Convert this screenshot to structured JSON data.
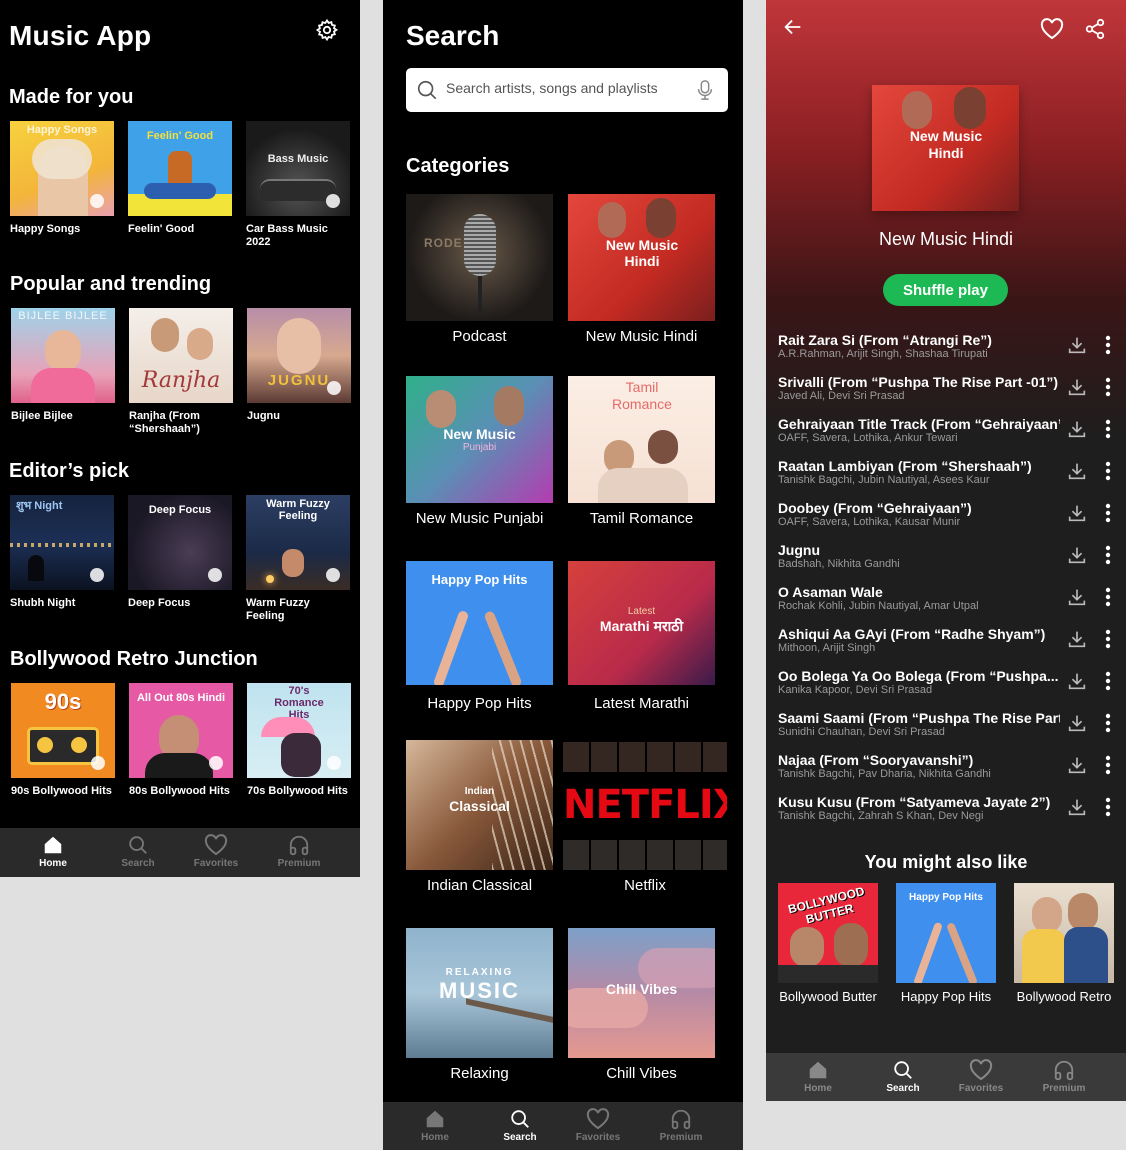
{
  "home": {
    "app_title": "Music App",
    "sections": [
      {
        "title": "Made for you",
        "items": [
          {
            "label": "Happy Songs",
            "art_text": "Happy Songs"
          },
          {
            "label": "Feelin' Good",
            "art_text": "Feelin' Good"
          },
          {
            "label": "Car Bass Music 2022",
            "art_text": "Bass Music"
          }
        ]
      },
      {
        "title": "Popular and trending",
        "items": [
          {
            "label": "Bijlee Bijlee",
            "art_text": "BIJLEE BIJLEE"
          },
          {
            "label": "Ranjha (From “Shershaah”)",
            "art_text": "Ranjha"
          },
          {
            "label": "Jugnu",
            "art_text": "JUGNU"
          }
        ]
      },
      {
        "title": "Editor’s pick",
        "items": [
          {
            "label": "Shubh Night",
            "art_text": "शुभ Night"
          },
          {
            "label": "Deep Focus",
            "art_text": "Deep Focus"
          },
          {
            "label": "Warm Fuzzy Feeling",
            "art_text": "Warm Fuzzy Feeling"
          }
        ]
      },
      {
        "title": "Bollywood Retro Junction",
        "items": [
          {
            "label": "90s Bollywood Hits",
            "art_text": "90s"
          },
          {
            "label": "80s Bollywood Hits",
            "art_text": "All Out 80s Hindi"
          },
          {
            "label": "70s Bollywood Hits",
            "art_text": "70's Romance Hits"
          }
        ]
      }
    ]
  },
  "nav": {
    "home": "Home",
    "search": "Search",
    "favorites": "Favorites",
    "premium": "Premium"
  },
  "search": {
    "title": "Search",
    "placeholder": "Search artists, songs and playlists",
    "categories_title": "Categories",
    "categories": [
      {
        "label": "Podcast",
        "art_text": "RODE"
      },
      {
        "label": "New Music Hindi",
        "art_text": "New Music Hindi"
      },
      {
        "label": "New Music Punjabi",
        "art_text": "New Music",
        "art_sub": "Punjabi"
      },
      {
        "label": "Tamil Romance",
        "art_text": "Tamil Romance"
      },
      {
        "label": "Happy Pop Hits",
        "art_text": "Happy Pop Hits"
      },
      {
        "label": "Latest Marathi",
        "art_text": "Latest",
        "art_sub": "Marathi मराठी"
      },
      {
        "label": "Indian Classical",
        "art_text": "Indian",
        "art_sub": "Classical"
      },
      {
        "label": "Netflix",
        "art_text": "NETFLIX"
      },
      {
        "label": "Relaxing",
        "art_text": "RELAXING",
        "art_sub": "MUSIC"
      },
      {
        "label": "Chill Vibes",
        "art_text": "Chill Vibes"
      }
    ]
  },
  "playlist": {
    "cover_text": "New Music Hindi",
    "title": "New Music Hindi",
    "shuffle_label": "Shuffle play",
    "tracks": [
      {
        "name": "Rait Zara Si (From “Atrangi Re”)",
        "artists": "A.R.Rahman, Arijit Singh, Shashaa Tirupati"
      },
      {
        "name": "Srivalli (From “Pushpa The Rise Part -01”)",
        "artists": "Javed Ali, Devi Sri Prasad"
      },
      {
        "name": "Gehraiyaan Title Track (From “Gehraiyaan”)",
        "artists": "OAFF, Savera, Lothika, Ankur Tewari"
      },
      {
        "name": "Raatan Lambiyan (From “Shershaah”)",
        "artists": "Tanishk Bagchi, Jubin Nautiyal, Asees Kaur"
      },
      {
        "name": "Doobey (From “Gehraiyaan”)",
        "artists": "OAFF, Savera, Lothika, Kausar Munir"
      },
      {
        "name": "Jugnu",
        "artists": "Badshah, Nikhita Gandhi"
      },
      {
        "name": "O Asaman Wale",
        "artists": "Rochak Kohli, Jubin Nautiyal, Amar Utpal"
      },
      {
        "name": "Ashiqui Aa GAyi (From “Radhe Shyam”)",
        "artists": "Mithoon, Arijit Singh"
      },
      {
        "name": "Oo Bolega Ya Oo Bolega (From “Pushpa...",
        "artists": "Kanika Kapoor, Devi Sri Prasad"
      },
      {
        "name": "Saami Saami (From “Pushpa The Rise Part...",
        "artists": "Sunidhi Chauhan, Devi Sri Prasad"
      },
      {
        "name": "Najaa (From “Sooryavanshi”)",
        "artists": "Tanishk Bagchi, Pav Dharia, Nikhita Gandhi"
      },
      {
        "name": "Kusu Kusu (From “Satyameva Jayate 2”)",
        "artists": "Tanishk Bagchi, Zahrah S Khan, Dev Negi"
      }
    ],
    "also_like_title": "You might also like",
    "recommendations": [
      {
        "label": "Bollywood Butter",
        "art_text": "BOLLYWOOD BUTTER"
      },
      {
        "label": "Happy Pop Hits",
        "art_text": "Happy Pop Hits"
      },
      {
        "label": "Bollywood Retro",
        "art_text": ""
      }
    ]
  },
  "icons": {
    "home": "home-icon",
    "search": "search-icon",
    "favorites": "heart-icon",
    "premium": "headphones-icon",
    "settings": "gear-icon",
    "back": "arrow-left-icon",
    "share": "share-icon",
    "mic": "microphone-icon",
    "download": "download-icon",
    "more": "more-vertical-icon"
  },
  "colors": {
    "accent_green": "#1db954",
    "background": "#000000",
    "navbar": "#2a2a2a",
    "playlist_header": "#c0363a"
  }
}
